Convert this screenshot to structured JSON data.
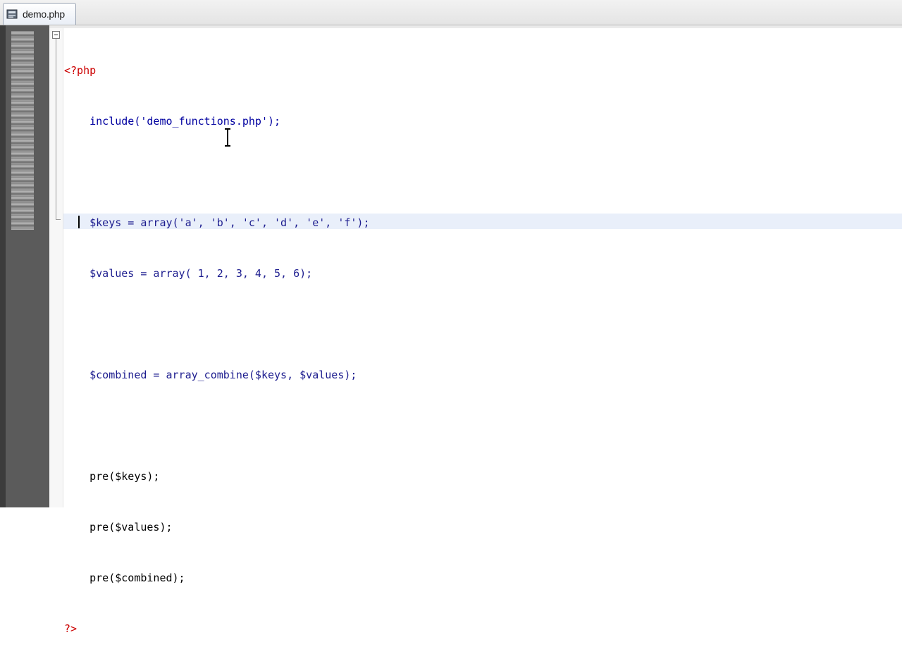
{
  "tab": {
    "label": "demo.php",
    "icon": "file-icon"
  },
  "editor": {
    "lines": [
      "<?php",
      "    include('demo_functions.php');",
      "",
      "    $keys = array('a', 'b', 'c', 'd', 'e', 'f');",
      "    $values = array( 1, 2, 3, 4, 5, 6);",
      "",
      "    $combined = array_combine($keys, $values);",
      "",
      "    pre($keys);",
      "    pre($values);",
      "    pre($combined);",
      "?>"
    ]
  },
  "colors": {
    "keyword": "#0000a0",
    "php_tag": "#cc0000",
    "number": "#d08a00",
    "current_line": "#e9effa"
  }
}
